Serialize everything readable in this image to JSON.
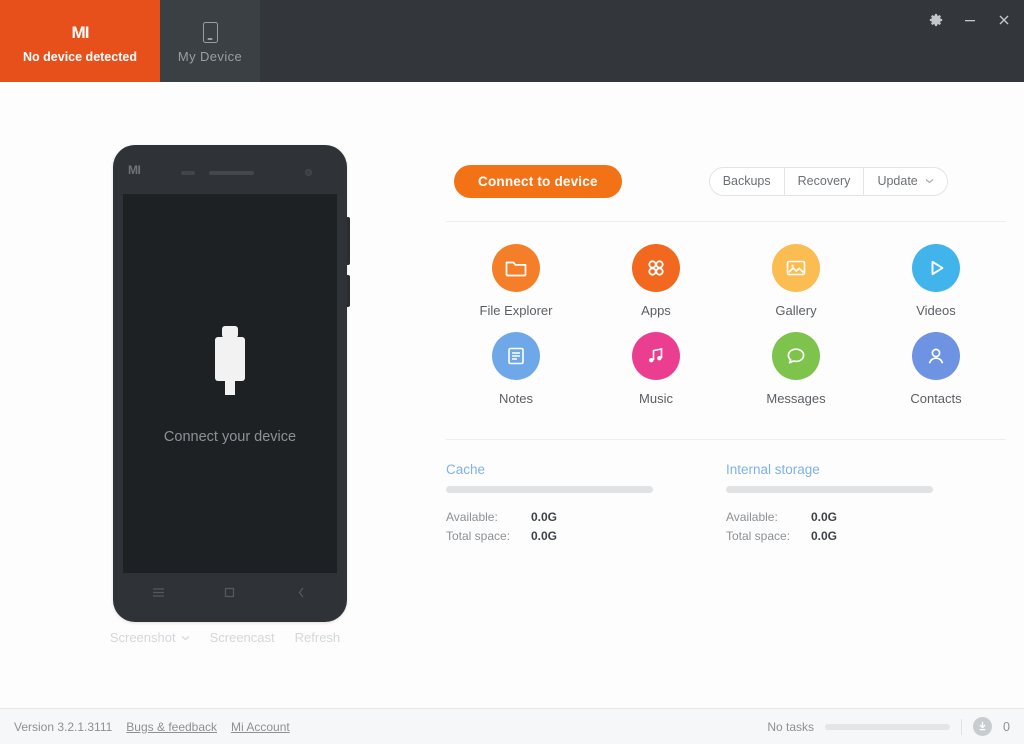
{
  "header": {
    "device_tab": {
      "logo": "MI",
      "label": "No device detected",
      "icon": "mi-logo-icon"
    },
    "my_device_tab": {
      "label": "My Device",
      "icon": "phone-icon"
    },
    "window_controls": [
      {
        "name": "settings",
        "icon": "gear-icon",
        "glyph": "⚙"
      },
      {
        "name": "minimize",
        "icon": "minimize-icon",
        "glyph": "–"
      },
      {
        "name": "close",
        "icon": "close-icon",
        "glyph": "✕"
      }
    ]
  },
  "phone": {
    "logo": "MI",
    "screen_text": "Connect your device",
    "usb_icon": "usb-plug-icon",
    "nav_buttons": [
      {
        "name": "menu",
        "icon": "menu-icon"
      },
      {
        "name": "home",
        "icon": "home-square-icon"
      },
      {
        "name": "back",
        "icon": "back-icon"
      }
    ],
    "tools": {
      "screenshot": "Screenshot",
      "screenshot_caret": "chevron-down-icon",
      "screencast": "Screencast",
      "refresh": "Refresh"
    }
  },
  "main": {
    "connect_button": "Connect to device",
    "segmented": [
      {
        "label": "Backups",
        "icon": null
      },
      {
        "label": "Recovery",
        "icon": null
      },
      {
        "label": "Update",
        "icon": "chevron-down-icon"
      }
    ],
    "apps": [
      {
        "label": "File Explorer",
        "icon": "folder-icon",
        "color": "#f47f28"
      },
      {
        "label": "Apps",
        "icon": "apps-grid-icon",
        "color": "#f1681e"
      },
      {
        "label": "Gallery",
        "icon": "image-icon",
        "color": "#fbbc52"
      },
      {
        "label": "Videos",
        "icon": "play-icon",
        "color": "#42b4ec"
      },
      {
        "label": "Notes",
        "icon": "note-icon",
        "color": "#6fa8e8"
      },
      {
        "label": "Music",
        "icon": "music-icon",
        "color": "#ec3e91"
      },
      {
        "label": "Messages",
        "icon": "chat-icon",
        "color": "#7ec34b"
      },
      {
        "label": "Contacts",
        "icon": "person-icon",
        "color": "#6f93e3"
      }
    ],
    "storage": [
      {
        "title": "Cache",
        "fill_percent": 0,
        "rows": [
          {
            "key": "Available:",
            "value": "0.0G"
          },
          {
            "key": "Total space:",
            "value": "0.0G"
          }
        ]
      },
      {
        "title": "Internal storage",
        "fill_percent": 0,
        "rows": [
          {
            "key": "Available:",
            "value": "0.0G"
          },
          {
            "key": "Total space:",
            "value": "0.0G"
          }
        ]
      }
    ]
  },
  "footer": {
    "version": "Version 3.2.1.3111",
    "bugs_link": "Bugs & feedback",
    "account_link": "Mi Account",
    "task_status": "No tasks",
    "task_progress": 0,
    "download_icon": "download-circle-icon",
    "download_count": "0"
  },
  "colors": {
    "header_bg": "#33373b",
    "device_tab_bg": "#e8501b",
    "my_device_tab_bg": "#3b4045",
    "accent_orange": "#f47216",
    "storage_title": "#7fb2e5",
    "phone_body": "#2f3337",
    "phone_screen": "#1e2124"
  }
}
